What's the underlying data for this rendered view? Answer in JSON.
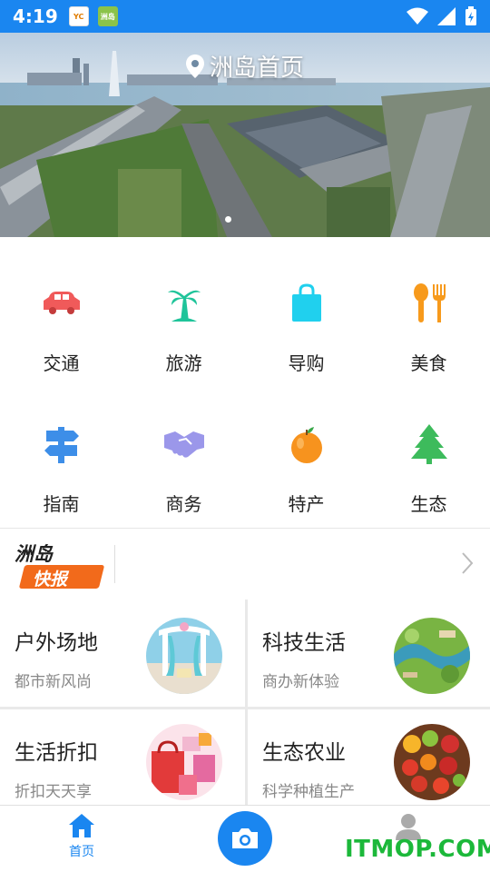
{
  "status_bar": {
    "time": "4:19"
  },
  "banner": {
    "title": "洲岛首页"
  },
  "categories": [
    {
      "label": "交通",
      "icon": "car-icon"
    },
    {
      "label": "旅游",
      "icon": "palm-tree-icon"
    },
    {
      "label": "导购",
      "icon": "shopping-bag-icon"
    },
    {
      "label": "美食",
      "icon": "fork-spoon-icon"
    },
    {
      "label": "指南",
      "icon": "signpost-icon"
    },
    {
      "label": "商务",
      "icon": "handshake-icon"
    },
    {
      "label": "特产",
      "icon": "orange-icon"
    },
    {
      "label": "生态",
      "icon": "tree-icon"
    }
  ],
  "news": {
    "logo_line1": "洲岛",
    "logo_line2": "快报"
  },
  "cards": [
    {
      "title": "户外场地",
      "subtitle": "都市新风尚"
    },
    {
      "title": "科技生活",
      "subtitle": "商办新体验"
    },
    {
      "title": "生活折扣",
      "subtitle": "折扣天天享"
    },
    {
      "title": "生态农业",
      "subtitle": "科学种植生产"
    }
  ],
  "tabbar": {
    "home_label": "首页"
  },
  "watermark": "ITMOP.COM",
  "colors": {
    "primary": "#1a86f0",
    "watermark": "#1cb83a"
  }
}
